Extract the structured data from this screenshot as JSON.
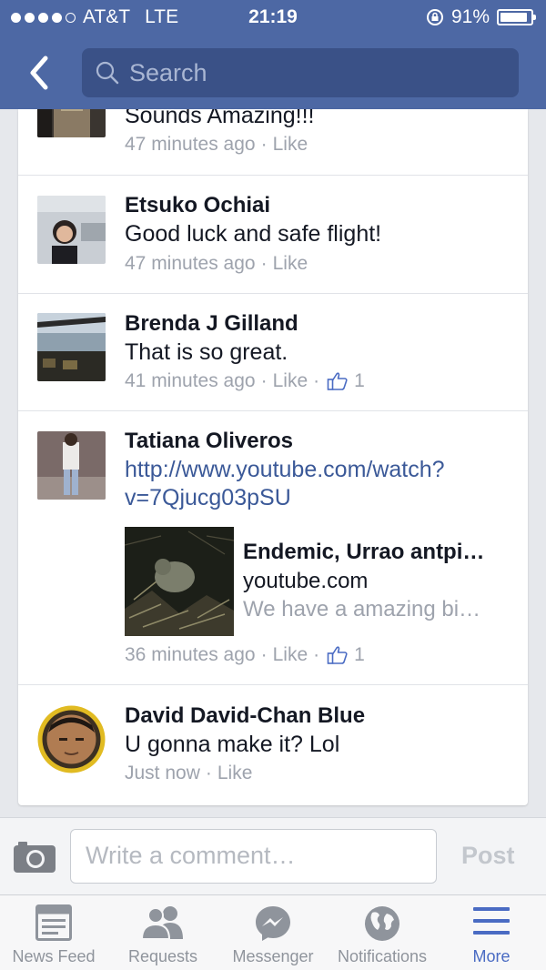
{
  "status_bar": {
    "carrier": "AT&T",
    "network": "LTE",
    "time": "21:19",
    "battery": "91%",
    "battery_fraction": 0.91
  },
  "header": {
    "search_placeholder": "Search"
  },
  "comments": [
    {
      "name": "",
      "text": "Sounds Amazing!!!",
      "time": "47 minutes ago",
      "like": "Like"
    },
    {
      "name": "Etsuko Ochiai",
      "text": "Good luck and safe flight!",
      "time": "47 minutes ago",
      "like": "Like"
    },
    {
      "name": "Brenda J Gilland",
      "text": "That is so great.",
      "time": "41 minutes ago",
      "like": "Like",
      "likes": "1"
    },
    {
      "name": "Tatiana Oliveros",
      "link_line1": "http://www.youtube.com/watch?",
      "link_line2": "v=7Qjucg03pSU",
      "preview": {
        "title": "Endemic, Urrao antpi…",
        "domain": "youtube.com",
        "description": "We have a amazing bi…"
      },
      "time": "36 minutes ago",
      "like": "Like",
      "likes": "1"
    },
    {
      "name": "David David-Chan Blue",
      "text": "U gonna make it? Lol",
      "time": "Just now",
      "like": "Like"
    }
  ],
  "composer": {
    "placeholder": "Write a comment…",
    "post_label": "Post"
  },
  "tabbar": [
    {
      "label": "News Feed",
      "icon": "news-feed-icon"
    },
    {
      "label": "Requests",
      "icon": "friend-requests-icon"
    },
    {
      "label": "Messenger",
      "icon": "messenger-icon"
    },
    {
      "label": "Notifications",
      "icon": "globe-icon"
    },
    {
      "label": "More",
      "icon": "menu-icon",
      "active": true
    }
  ],
  "colors": {
    "header": "#4d68a4",
    "link": "#3b5998",
    "active_tab": "#4a6bc3"
  }
}
